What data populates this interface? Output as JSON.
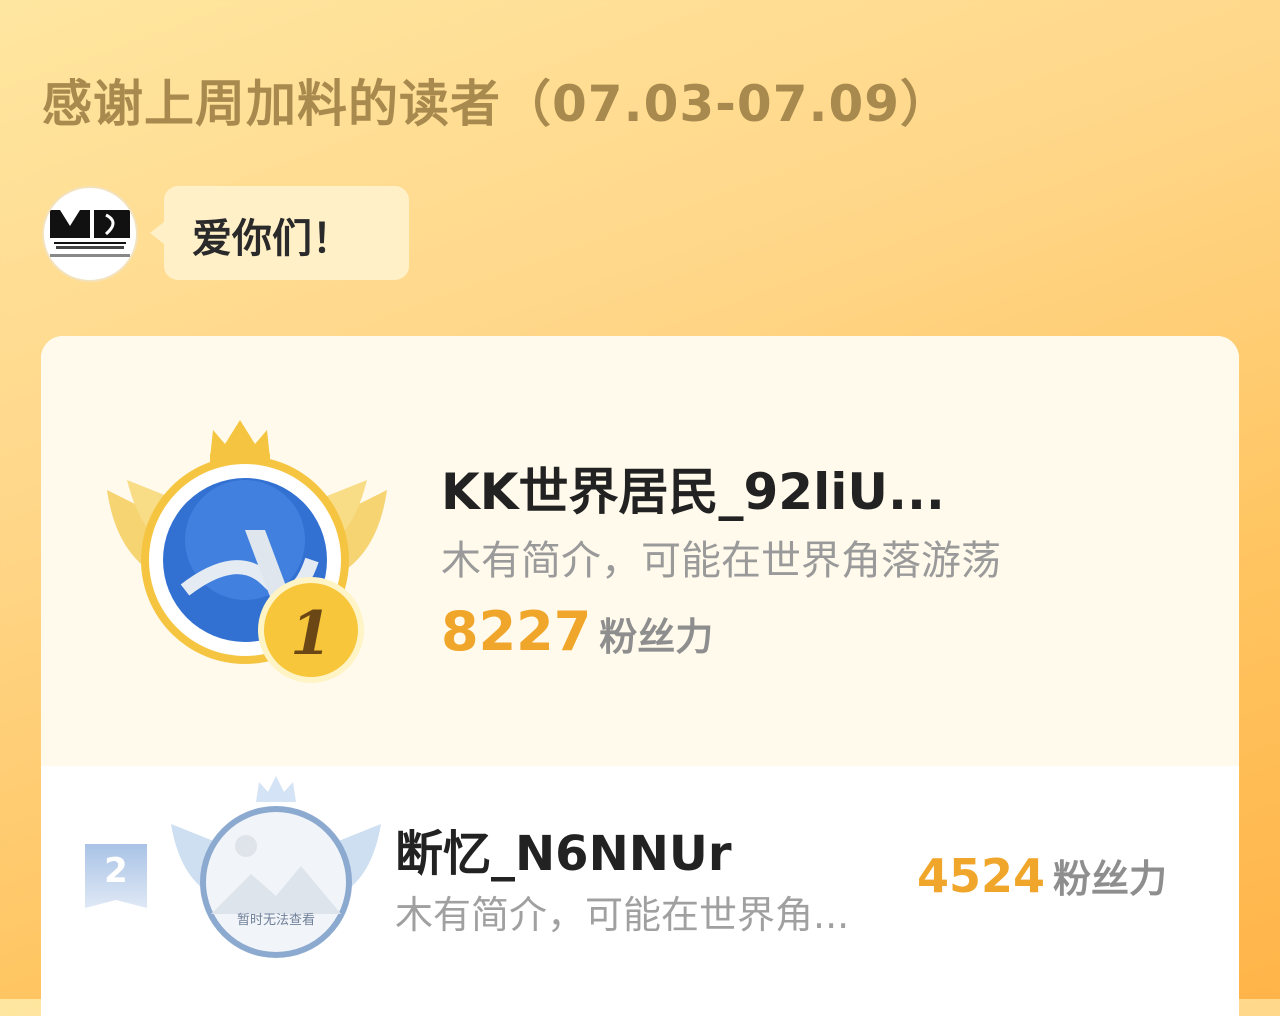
{
  "header": {
    "title": "感谢上周加料的读者（07.03-07.09）"
  },
  "author": {
    "avatar_icon": "brand-logo-avatar",
    "message": "爱你们！"
  },
  "ranking": [
    {
      "rank": "1",
      "name": "KK世界居民_92liU...",
      "bio": "木有简介，可能在世界角落游荡",
      "fans_value": "8227",
      "fans_label": "粉丝力"
    },
    {
      "rank": "2",
      "name": "断忆_N6NNUr",
      "bio": "木有简介，可能在世界角...",
      "fans_value": "4524",
      "fans_label": "粉丝力",
      "avatar_placeholder": "暂时无法查看"
    }
  ],
  "colors": {
    "accent": "#f0a62a",
    "title": "#a88a4e",
    "gold": "#f5c542",
    "silver_blue": "#b9d0ec"
  }
}
